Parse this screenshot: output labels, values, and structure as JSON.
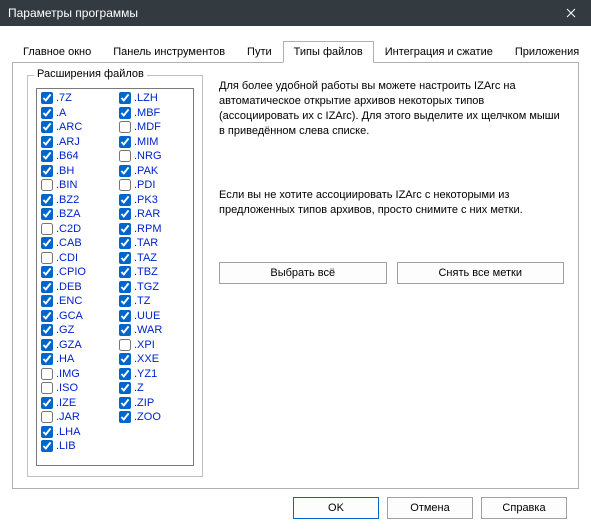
{
  "window": {
    "title": "Параметры программы"
  },
  "tabs": {
    "main": "Главное окно",
    "toolbar": "Панель инструментов",
    "paths": "Пути",
    "filetypes": "Типы файлов",
    "integration": "Интеграция и сжатие",
    "apps": "Приложения"
  },
  "group": {
    "title": "Расширения файлов"
  },
  "extensions": [
    {
      "label": ".7Z",
      "checked": true
    },
    {
      "label": ".A",
      "checked": true
    },
    {
      "label": ".ARC",
      "checked": true
    },
    {
      "label": ".ARJ",
      "checked": true
    },
    {
      "label": ".B64",
      "checked": true
    },
    {
      "label": ".BH",
      "checked": true
    },
    {
      "label": ".BIN",
      "checked": false
    },
    {
      "label": ".BZ2",
      "checked": true
    },
    {
      "label": ".BZA",
      "checked": true
    },
    {
      "label": ".C2D",
      "checked": false
    },
    {
      "label": ".CAB",
      "checked": true
    },
    {
      "label": ".CDI",
      "checked": false
    },
    {
      "label": ".CPIO",
      "checked": true
    },
    {
      "label": ".DEB",
      "checked": true
    },
    {
      "label": ".ENC",
      "checked": true
    },
    {
      "label": ".GCA",
      "checked": true
    },
    {
      "label": ".GZ",
      "checked": true
    },
    {
      "label": ".GZA",
      "checked": true
    },
    {
      "label": ".HA",
      "checked": true
    },
    {
      "label": ".IMG",
      "checked": false
    },
    {
      "label": ".ISO",
      "checked": false
    },
    {
      "label": ".IZE",
      "checked": true
    },
    {
      "label": ".JAR",
      "checked": false
    },
    {
      "label": ".LHA",
      "checked": true
    },
    {
      "label": ".LIB",
      "checked": true
    },
    {
      "label": ".LZH",
      "checked": true
    },
    {
      "label": ".MBF",
      "checked": true
    },
    {
      "label": ".MDF",
      "checked": false
    },
    {
      "label": ".MIM",
      "checked": true
    },
    {
      "label": ".NRG",
      "checked": false
    },
    {
      "label": ".PAK",
      "checked": true
    },
    {
      "label": ".PDI",
      "checked": false
    },
    {
      "label": ".PK3",
      "checked": true
    },
    {
      "label": ".RAR",
      "checked": true
    },
    {
      "label": ".RPM",
      "checked": true
    },
    {
      "label": ".TAR",
      "checked": true
    },
    {
      "label": ".TAZ",
      "checked": true
    },
    {
      "label": ".TBZ",
      "checked": true
    },
    {
      "label": ".TGZ",
      "checked": true
    },
    {
      "label": ".TZ",
      "checked": true
    },
    {
      "label": ".UUE",
      "checked": true
    },
    {
      "label": ".WAR",
      "checked": true
    },
    {
      "label": ".XPI",
      "checked": false
    },
    {
      "label": ".XXE",
      "checked": true
    },
    {
      "label": ".YZ1",
      "checked": true
    },
    {
      "label": ".Z",
      "checked": true
    },
    {
      "label": ".ZIP",
      "checked": true
    },
    {
      "label": ".ZOO",
      "checked": true
    }
  ],
  "text": {
    "para1": "Для более удобной работы вы можете настроить IZArc на автоматическое открытие архивов некоторых типов (ассоциировать их с IZArc). Для этого выделите их щелчком мыши в  приведённом слева списке.",
    "para2": "Если вы не хотите ассоциировать IZArc с некоторыми из предложенных типов архивов, просто снимите с них метки."
  },
  "buttons": {
    "select_all": "Выбрать всё",
    "clear_all": "Снять все метки",
    "ok": "OK",
    "cancel": "Отмена",
    "help": "Справка"
  }
}
